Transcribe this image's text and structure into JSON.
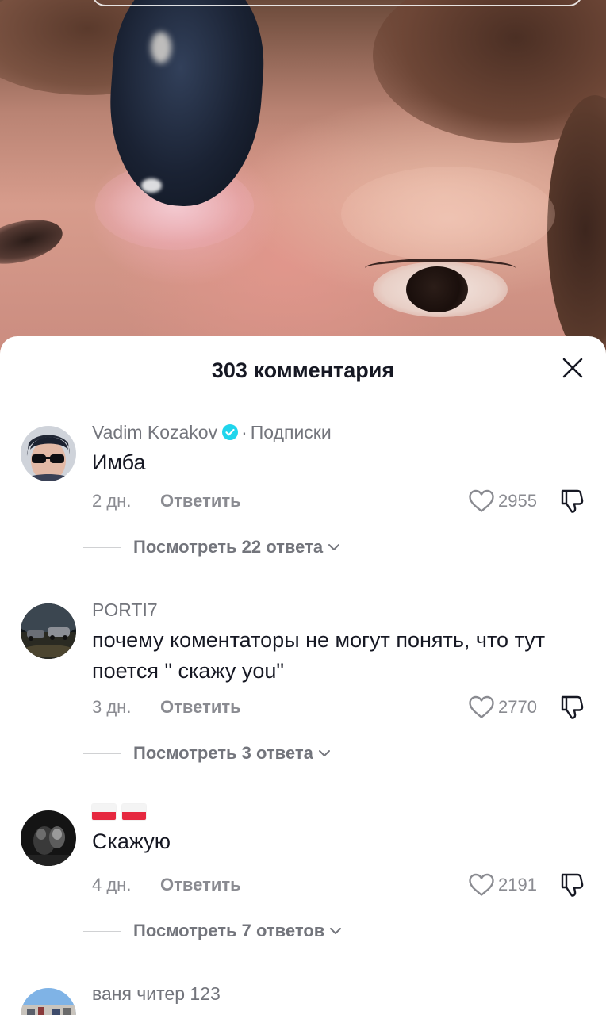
{
  "sheet": {
    "title": "303 комментария"
  },
  "comments": [
    {
      "author": "Vadim Kozakov",
      "verified": true,
      "separator": "·",
      "relation": "Подписки",
      "text": "Имба",
      "date": "2 дн.",
      "reply_label": "Ответить",
      "likes": "2955",
      "view_replies": "Посмотреть 22 ответа"
    },
    {
      "author": "PORTI7",
      "text": "почему коментаторы не могут понять, что тут поется \" скажу you\"",
      "date": "3 дн.",
      "reply_label": "Ответить",
      "likes": "2770",
      "view_replies": "Посмотреть 3 ответа"
    },
    {
      "author_flags": [
        "flag-poland",
        "flag-poland"
      ],
      "text": "Скажую",
      "date": "4 дн.",
      "reply_label": "Ответить",
      "likes": "2191",
      "view_replies": "Посмотреть 7 ответов"
    },
    {
      "author": "ваня читер 123"
    }
  ],
  "icons": {
    "close": "close-icon",
    "verified": "verified-badge-icon",
    "like": "heart-outline-icon",
    "dislike": "thumbs-down-icon",
    "expand": "chevron-down-icon"
  },
  "colors": {
    "verified_badge": "#20d5ec",
    "text_primary": "#161823",
    "text_secondary": "#73757c",
    "flag_red": "#e6283f"
  }
}
